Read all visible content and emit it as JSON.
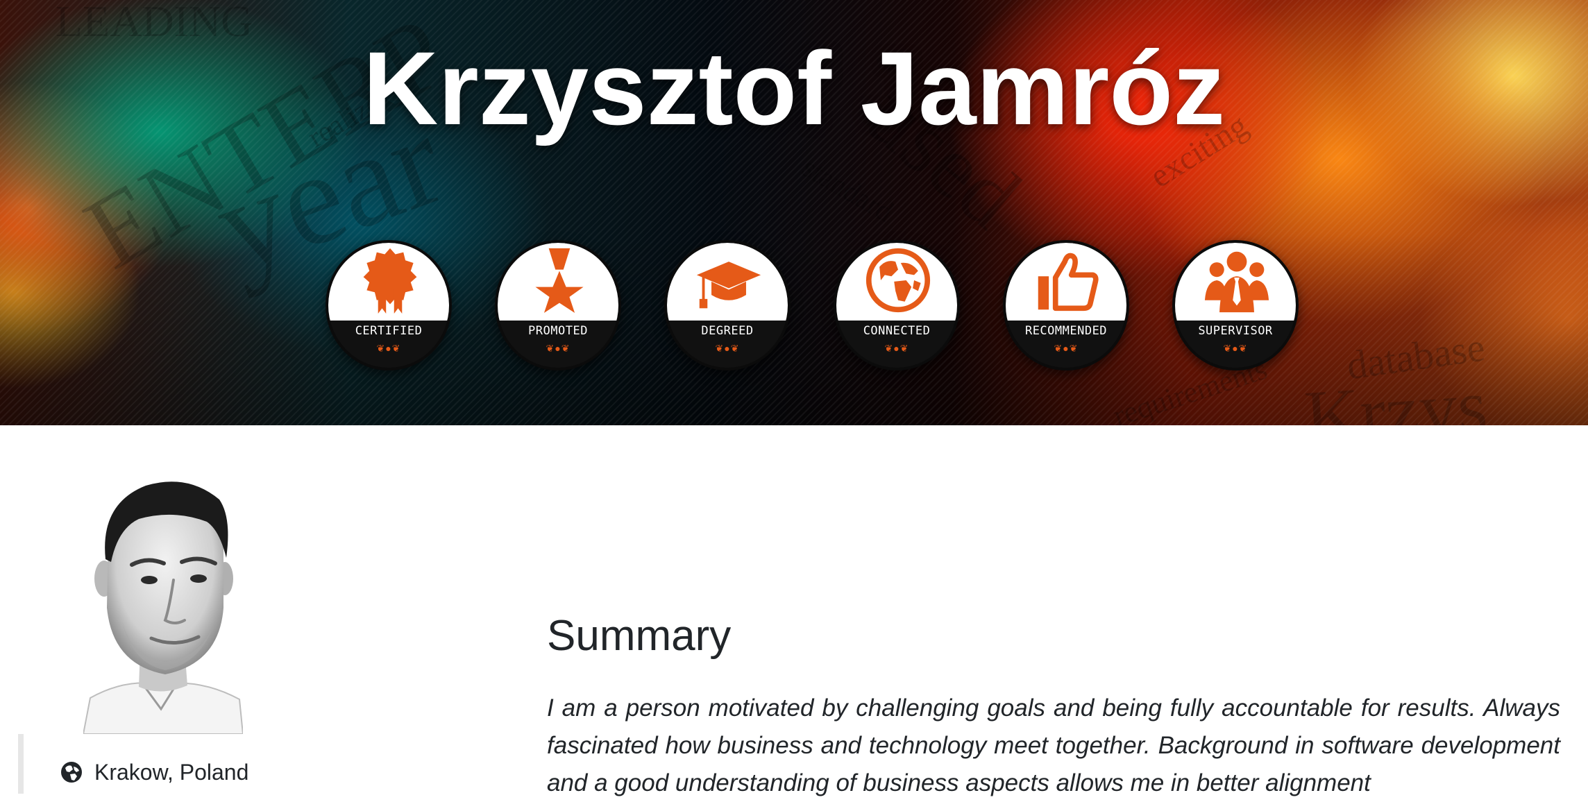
{
  "hero": {
    "title": "Krzysztof Jamróz",
    "background_words": [
      "LEADING",
      "ENTERP",
      "year",
      "realize",
      "standard",
      "used",
      "exciting",
      "database",
      "Krzys",
      "requirements"
    ]
  },
  "badges": [
    {
      "label": "CERTIFIED",
      "icon": "award-ribbon-icon"
    },
    {
      "label": "PROMOTED",
      "icon": "star-medal-icon"
    },
    {
      "label": "DEGREED",
      "icon": "graduation-cap-icon"
    },
    {
      "label": "CONNECTED",
      "icon": "globe-icon"
    },
    {
      "label": "RECOMMENDED",
      "icon": "thumbs-up-icon"
    },
    {
      "label": "SUPERVISOR",
      "icon": "team-icon"
    }
  ],
  "sidebar": {
    "photo_icon": "profile-photo",
    "location": "Krakow, Poland",
    "location_icon": "globe-icon"
  },
  "summary": {
    "heading": "Summary",
    "text": "I am a person motivated by challenging goals and being fully accountable for results. Always fascinated how business and technology meet together. Background in software development and a good understanding of business aspects allows me in better alignment"
  },
  "colors": {
    "accent": "#e55a18",
    "text": "#212529",
    "badge_dark": "#111111"
  }
}
